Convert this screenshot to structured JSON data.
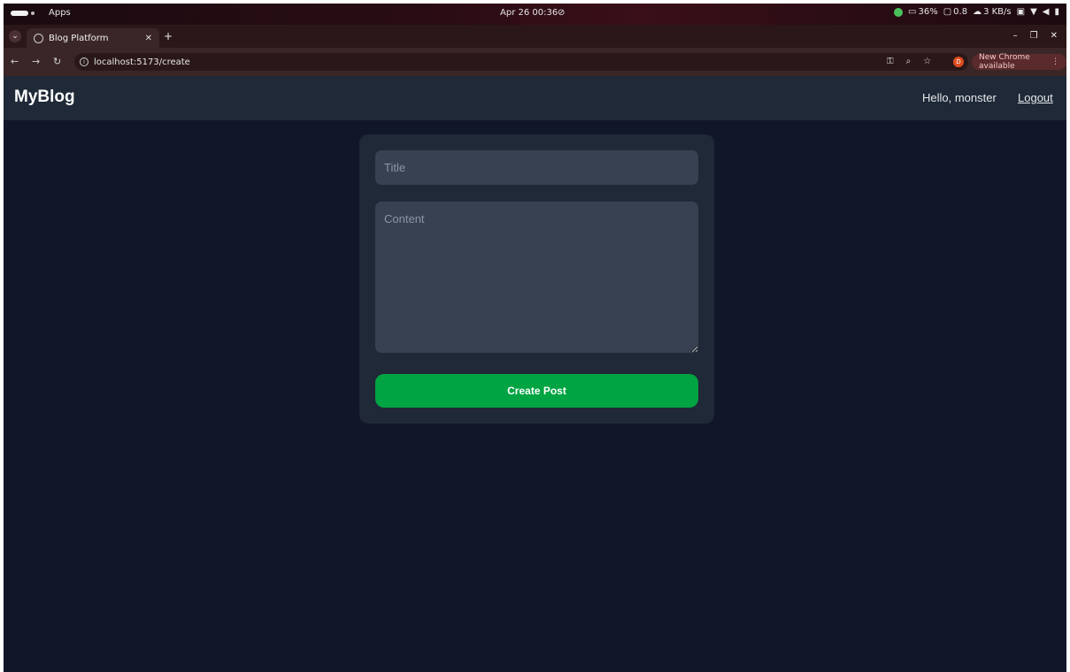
{
  "os_bar": {
    "apps_label": "Apps",
    "clock": "Apr 26 00:36",
    "clock_icon": "⊘",
    "cpu": "36%",
    "mem": "0.8",
    "net": "3 KB/s"
  },
  "browser": {
    "tab_title": "Blog Platform",
    "url": "localhost:5173/create",
    "profile_initial": "D",
    "update_label": "New Chrome available"
  },
  "header": {
    "brand": "MyBlog",
    "greeting": "Hello, monster",
    "logout_label": "Logout"
  },
  "form": {
    "title_placeholder": "Title",
    "title_value": "",
    "content_placeholder": "Content",
    "content_value": "",
    "submit_label": "Create Post"
  },
  "colors": {
    "page_bg": "#111729",
    "card_bg": "#1f2937",
    "input_bg": "#374151",
    "submit_bg": "#00a442"
  },
  "icons": [
    "menu-pill-icon",
    "tab-favicon-icon",
    "close-icon",
    "plus-icon",
    "back-icon",
    "forward-icon",
    "reload-icon",
    "info-icon",
    "key-icon",
    "zoom-icon",
    "star-icon",
    "more-vert-icon"
  ]
}
